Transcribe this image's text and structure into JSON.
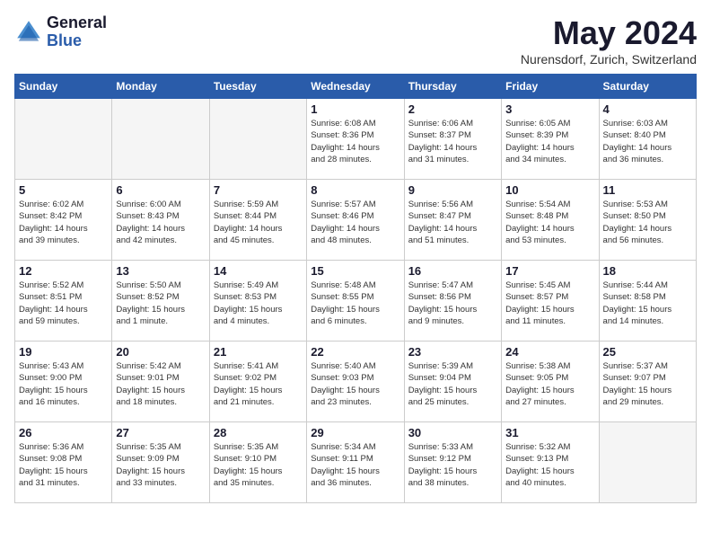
{
  "header": {
    "logo_general": "General",
    "logo_blue": "Blue",
    "month_title": "May 2024",
    "location": "Nurensdorf, Zurich, Switzerland"
  },
  "weekdays": [
    "Sunday",
    "Monday",
    "Tuesday",
    "Wednesday",
    "Thursday",
    "Friday",
    "Saturday"
  ],
  "weeks": [
    [
      {
        "num": "",
        "info": ""
      },
      {
        "num": "",
        "info": ""
      },
      {
        "num": "",
        "info": ""
      },
      {
        "num": "1",
        "info": "Sunrise: 6:08 AM\nSunset: 8:36 PM\nDaylight: 14 hours\nand 28 minutes."
      },
      {
        "num": "2",
        "info": "Sunrise: 6:06 AM\nSunset: 8:37 PM\nDaylight: 14 hours\nand 31 minutes."
      },
      {
        "num": "3",
        "info": "Sunrise: 6:05 AM\nSunset: 8:39 PM\nDaylight: 14 hours\nand 34 minutes."
      },
      {
        "num": "4",
        "info": "Sunrise: 6:03 AM\nSunset: 8:40 PM\nDaylight: 14 hours\nand 36 minutes."
      }
    ],
    [
      {
        "num": "5",
        "info": "Sunrise: 6:02 AM\nSunset: 8:42 PM\nDaylight: 14 hours\nand 39 minutes."
      },
      {
        "num": "6",
        "info": "Sunrise: 6:00 AM\nSunset: 8:43 PM\nDaylight: 14 hours\nand 42 minutes."
      },
      {
        "num": "7",
        "info": "Sunrise: 5:59 AM\nSunset: 8:44 PM\nDaylight: 14 hours\nand 45 minutes."
      },
      {
        "num": "8",
        "info": "Sunrise: 5:57 AM\nSunset: 8:46 PM\nDaylight: 14 hours\nand 48 minutes."
      },
      {
        "num": "9",
        "info": "Sunrise: 5:56 AM\nSunset: 8:47 PM\nDaylight: 14 hours\nand 51 minutes."
      },
      {
        "num": "10",
        "info": "Sunrise: 5:54 AM\nSunset: 8:48 PM\nDaylight: 14 hours\nand 53 minutes."
      },
      {
        "num": "11",
        "info": "Sunrise: 5:53 AM\nSunset: 8:50 PM\nDaylight: 14 hours\nand 56 minutes."
      }
    ],
    [
      {
        "num": "12",
        "info": "Sunrise: 5:52 AM\nSunset: 8:51 PM\nDaylight: 14 hours\nand 59 minutes."
      },
      {
        "num": "13",
        "info": "Sunrise: 5:50 AM\nSunset: 8:52 PM\nDaylight: 15 hours\nand 1 minute."
      },
      {
        "num": "14",
        "info": "Sunrise: 5:49 AM\nSunset: 8:53 PM\nDaylight: 15 hours\nand 4 minutes."
      },
      {
        "num": "15",
        "info": "Sunrise: 5:48 AM\nSunset: 8:55 PM\nDaylight: 15 hours\nand 6 minutes."
      },
      {
        "num": "16",
        "info": "Sunrise: 5:47 AM\nSunset: 8:56 PM\nDaylight: 15 hours\nand 9 minutes."
      },
      {
        "num": "17",
        "info": "Sunrise: 5:45 AM\nSunset: 8:57 PM\nDaylight: 15 hours\nand 11 minutes."
      },
      {
        "num": "18",
        "info": "Sunrise: 5:44 AM\nSunset: 8:58 PM\nDaylight: 15 hours\nand 14 minutes."
      }
    ],
    [
      {
        "num": "19",
        "info": "Sunrise: 5:43 AM\nSunset: 9:00 PM\nDaylight: 15 hours\nand 16 minutes."
      },
      {
        "num": "20",
        "info": "Sunrise: 5:42 AM\nSunset: 9:01 PM\nDaylight: 15 hours\nand 18 minutes."
      },
      {
        "num": "21",
        "info": "Sunrise: 5:41 AM\nSunset: 9:02 PM\nDaylight: 15 hours\nand 21 minutes."
      },
      {
        "num": "22",
        "info": "Sunrise: 5:40 AM\nSunset: 9:03 PM\nDaylight: 15 hours\nand 23 minutes."
      },
      {
        "num": "23",
        "info": "Sunrise: 5:39 AM\nSunset: 9:04 PM\nDaylight: 15 hours\nand 25 minutes."
      },
      {
        "num": "24",
        "info": "Sunrise: 5:38 AM\nSunset: 9:05 PM\nDaylight: 15 hours\nand 27 minutes."
      },
      {
        "num": "25",
        "info": "Sunrise: 5:37 AM\nSunset: 9:07 PM\nDaylight: 15 hours\nand 29 minutes."
      }
    ],
    [
      {
        "num": "26",
        "info": "Sunrise: 5:36 AM\nSunset: 9:08 PM\nDaylight: 15 hours\nand 31 minutes."
      },
      {
        "num": "27",
        "info": "Sunrise: 5:35 AM\nSunset: 9:09 PM\nDaylight: 15 hours\nand 33 minutes."
      },
      {
        "num": "28",
        "info": "Sunrise: 5:35 AM\nSunset: 9:10 PM\nDaylight: 15 hours\nand 35 minutes."
      },
      {
        "num": "29",
        "info": "Sunrise: 5:34 AM\nSunset: 9:11 PM\nDaylight: 15 hours\nand 36 minutes."
      },
      {
        "num": "30",
        "info": "Sunrise: 5:33 AM\nSunset: 9:12 PM\nDaylight: 15 hours\nand 38 minutes."
      },
      {
        "num": "31",
        "info": "Sunrise: 5:32 AM\nSunset: 9:13 PM\nDaylight: 15 hours\nand 40 minutes."
      },
      {
        "num": "",
        "info": ""
      }
    ]
  ]
}
